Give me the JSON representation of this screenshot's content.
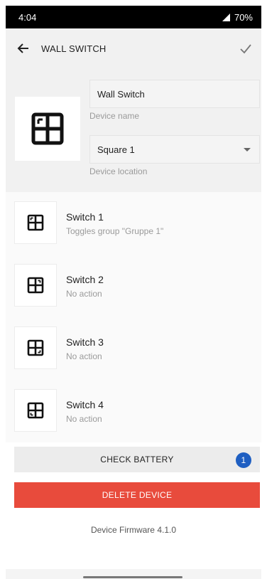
{
  "status_bar": {
    "time": "4:04",
    "battery": "70%"
  },
  "app_bar": {
    "title": "WALL SWITCH",
    "back_icon": "arrow-left-icon",
    "confirm_icon": "checkmark-icon"
  },
  "device": {
    "name_value": "Wall Switch",
    "name_label": "Device name",
    "location_value": "Square 1",
    "location_label": "Device location",
    "image_icon": "wall-switch-icon"
  },
  "switches": [
    {
      "name": "Switch 1",
      "action": "Toggles group \"Gruppe 1\""
    },
    {
      "name": "Switch 2",
      "action": "No action"
    },
    {
      "name": "Switch 3",
      "action": "No action"
    },
    {
      "name": "Switch 4",
      "action": "No action"
    }
  ],
  "battery_button": {
    "label": "CHECK BATTERY",
    "badge": "1"
  },
  "delete_button": {
    "label": "DELETE DEVICE"
  },
  "firmware": "Device Firmware 4.1.0",
  "colors": {
    "delete": "#e84b3c",
    "badge": "#1f5fc2",
    "panel": "#f1f1f1"
  }
}
